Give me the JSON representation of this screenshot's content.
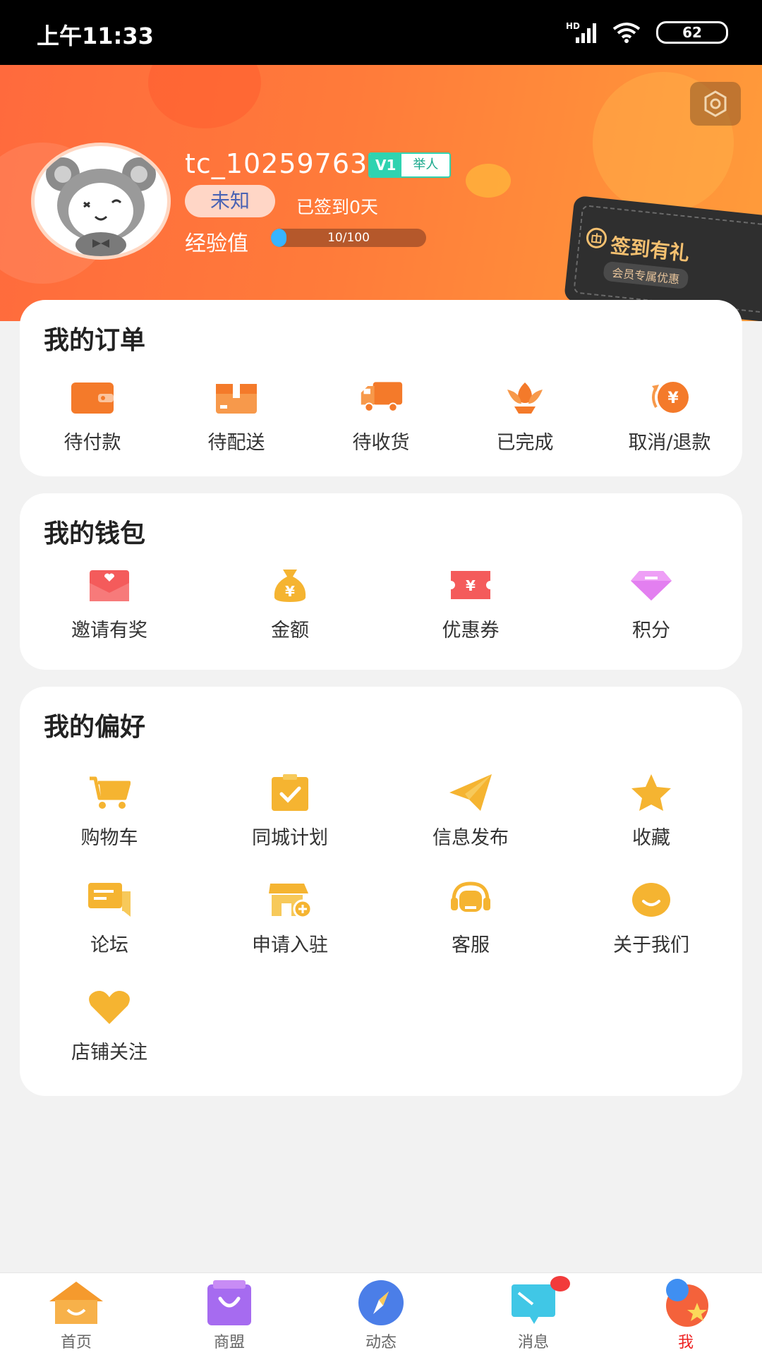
{
  "status_bar": {
    "time": "上午11:33",
    "signal_label": "HD",
    "battery": "62"
  },
  "profile": {
    "username": "tc_10259763",
    "vip_level": "V1",
    "vip_title": "举人",
    "gender": "未知",
    "signin_days": "已签到0天",
    "exp_label": "经验值",
    "exp_text": "10/100",
    "exp_fraction": 0.1,
    "signin_card_title": "签到有礼",
    "signin_card_sub": "会员专属优惠"
  },
  "orders": {
    "title": "我的订单",
    "items": [
      {
        "label": "待付款",
        "icon": "wallet-icon"
      },
      {
        "label": "待配送",
        "icon": "package-icon"
      },
      {
        "label": "待收货",
        "icon": "truck-icon"
      },
      {
        "label": "已完成",
        "icon": "lotus-icon"
      },
      {
        "label": "取消/退款",
        "icon": "refund-icon"
      }
    ]
  },
  "wallet": {
    "title": "我的钱包",
    "items": [
      {
        "label": "邀请有奖",
        "icon": "envelope-icon"
      },
      {
        "label": "金额",
        "icon": "money-bag-icon"
      },
      {
        "label": "优惠券",
        "icon": "coupon-icon"
      },
      {
        "label": "积分",
        "icon": "diamond-icon"
      }
    ]
  },
  "preferences": {
    "title": "我的偏好",
    "items": [
      {
        "label": "购物车",
        "icon": "cart-icon"
      },
      {
        "label": "同城计划",
        "icon": "clipboard-check-icon"
      },
      {
        "label": "信息发布",
        "icon": "paper-plane-icon"
      },
      {
        "label": "收藏",
        "icon": "star-icon"
      },
      {
        "label": "论坛",
        "icon": "chat-icon"
      },
      {
        "label": "申请入驻",
        "icon": "store-add-icon"
      },
      {
        "label": "客服",
        "icon": "headset-icon"
      },
      {
        "label": "关于我们",
        "icon": "smile-icon"
      },
      {
        "label": "店铺关注",
        "icon": "heart-icon"
      }
    ]
  },
  "tabbar": {
    "items": [
      {
        "label": "首页",
        "icon": "home-icon"
      },
      {
        "label": "商盟",
        "icon": "shop-bag-icon"
      },
      {
        "label": "动态",
        "icon": "compass-icon"
      },
      {
        "label": "消息",
        "icon": "message-icon"
      },
      {
        "label": "我",
        "icon": "profile-icon"
      }
    ]
  },
  "colors": {
    "accent": "#ff7a3a",
    "icon_orange": "#f47a2a",
    "icon_yellow": "#f5b431",
    "active_tab": "#e22222"
  }
}
